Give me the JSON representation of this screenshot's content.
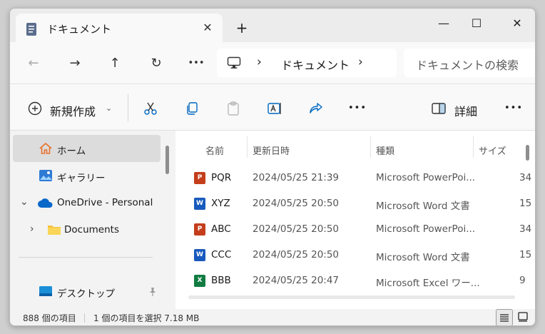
{
  "tab": {
    "title": "ドキュメント",
    "close": "✕",
    "new_tab": "+"
  },
  "window_controls": {
    "minimize": "—",
    "maximize": "☐",
    "close": "✕"
  },
  "nav": {
    "back": "←",
    "forward": "→",
    "up": "↑",
    "refresh": "↻",
    "more": "•••"
  },
  "address": {
    "chevron1": "›",
    "location": "ドキュメント",
    "chevron2": "›"
  },
  "search": {
    "placeholder": "ドキュメントの検索"
  },
  "command_bar": {
    "new_label": "新規作成",
    "new_chevron": "⌄",
    "more": "•••",
    "details_label": "詳細",
    "more2": "•••"
  },
  "sidebar": {
    "items": [
      {
        "label": "ホーム",
        "icon": "home-icon",
        "active": true
      },
      {
        "label": "ギャラリー",
        "icon": "gallery-icon"
      },
      {
        "label": "OneDrive - Personal",
        "icon": "cloud-icon",
        "chevron": "⌄"
      },
      {
        "label": "Documents",
        "icon": "folder-icon",
        "chevron": "›"
      },
      {
        "label": "デスクトップ",
        "icon": "desktop-icon",
        "pin": "📌"
      }
    ]
  },
  "file_list": {
    "columns": [
      "名前",
      "更新日時",
      "種類",
      "サイズ"
    ],
    "rows": [
      {
        "name": "PQR",
        "date": "2024/05/25 21:39",
        "type": "Microsoft PowerPoi...",
        "size": "34",
        "icon": "powerpoint-icon",
        "icon_letter": "P",
        "color": "#c43e1c"
      },
      {
        "name": "XYZ",
        "date": "2024/05/25 20:50",
        "type": "Microsoft Word 文書",
        "size": "15",
        "icon": "word-icon",
        "icon_letter": "W",
        "color": "#185abd"
      },
      {
        "name": "ABC",
        "date": "2024/05/25 20:50",
        "type": "Microsoft PowerPoi...",
        "size": "34",
        "icon": "powerpoint-icon",
        "icon_letter": "P",
        "color": "#c43e1c"
      },
      {
        "name": "CCC",
        "date": "2024/05/25 20:50",
        "type": "Microsoft Word 文書",
        "size": "15",
        "icon": "word-icon",
        "icon_letter": "W",
        "color": "#185abd"
      },
      {
        "name": "BBB",
        "date": "2024/05/25 20:47",
        "type": "Microsoft Excel ワー...",
        "size": "9",
        "icon": "excel-icon",
        "icon_letter": "X",
        "color": "#107c41"
      }
    ]
  },
  "status": {
    "count": "888 個の項目",
    "selection": "1 個の項目を選択  7.18 MB"
  },
  "colors": {
    "accent": "#0067c0",
    "folder": "#f5c33b",
    "home": "#e8742f"
  }
}
